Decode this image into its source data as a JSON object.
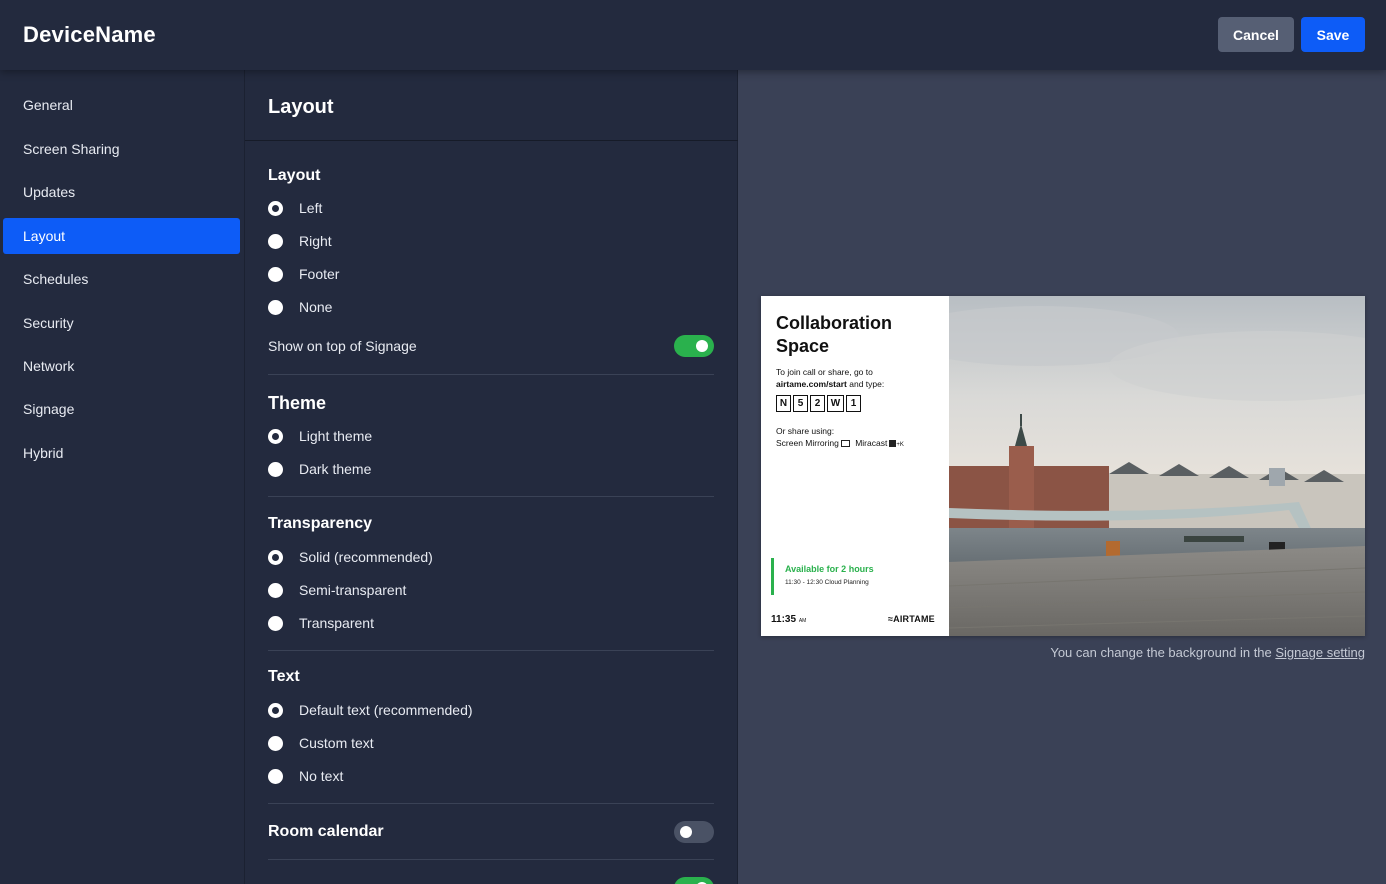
{
  "app": {
    "title": "DeviceName"
  },
  "toolbar": {
    "cancel_label": "Cancel",
    "save_label": "Save"
  },
  "sidebar": {
    "items": [
      {
        "label": "General"
      },
      {
        "label": "Screen Sharing"
      },
      {
        "label": "Updates"
      },
      {
        "label": "Layout",
        "active": true
      },
      {
        "label": "Schedules"
      },
      {
        "label": "Security"
      },
      {
        "label": "Network"
      },
      {
        "label": "Signage"
      },
      {
        "label": "Hybrid"
      }
    ]
  },
  "panel": {
    "title": "Layout",
    "layout": {
      "title": "Layout",
      "options": [
        "Left",
        "Right",
        "Footer",
        "None"
      ],
      "selected": "Left",
      "toggle_label": "Show on top of Signage",
      "toggle_on": true
    },
    "theme": {
      "title": "Theme",
      "options": [
        "Light theme",
        "Dark theme"
      ],
      "selected": "Light theme"
    },
    "transparency": {
      "title": "Transparency",
      "options": [
        "Solid (recommended)",
        "Semi-transparent",
        "Transparent"
      ],
      "selected": "Solid (recommended)"
    },
    "text": {
      "title": "Text",
      "options": [
        "Default text (recommended)",
        "Custom text",
        "No text"
      ],
      "selected": "Default text (recommended)"
    },
    "room_calendar": {
      "label": "Room calendar",
      "on": false
    },
    "next_toggle": {
      "on": true
    }
  },
  "preview": {
    "title": "Collaboration Space",
    "join_line1": "To join call or share, go to",
    "join_url": "airtame.com/start",
    "join_suffix": " and type:",
    "code": [
      "N",
      "5",
      "2",
      "W",
      "1"
    ],
    "share_label": "Or share using:",
    "share_method1": "Screen Mirroring",
    "share_method2": "Miracast",
    "share_method2_suffix": "+K",
    "available_title": "Available for 2 hours",
    "available_sub": "11:30 - 12:30 Cloud Planning",
    "time": "11:35",
    "time_suffix": "AM",
    "brand": "≈AIRTAME",
    "note_prefix": "You can change the background in the ",
    "note_link": "Signage setting"
  },
  "colors": {
    "accent": "#0d5cf7",
    "toggle_on": "#2ab14d",
    "background": "#232a3e",
    "preview_bg": "#3a4156"
  }
}
